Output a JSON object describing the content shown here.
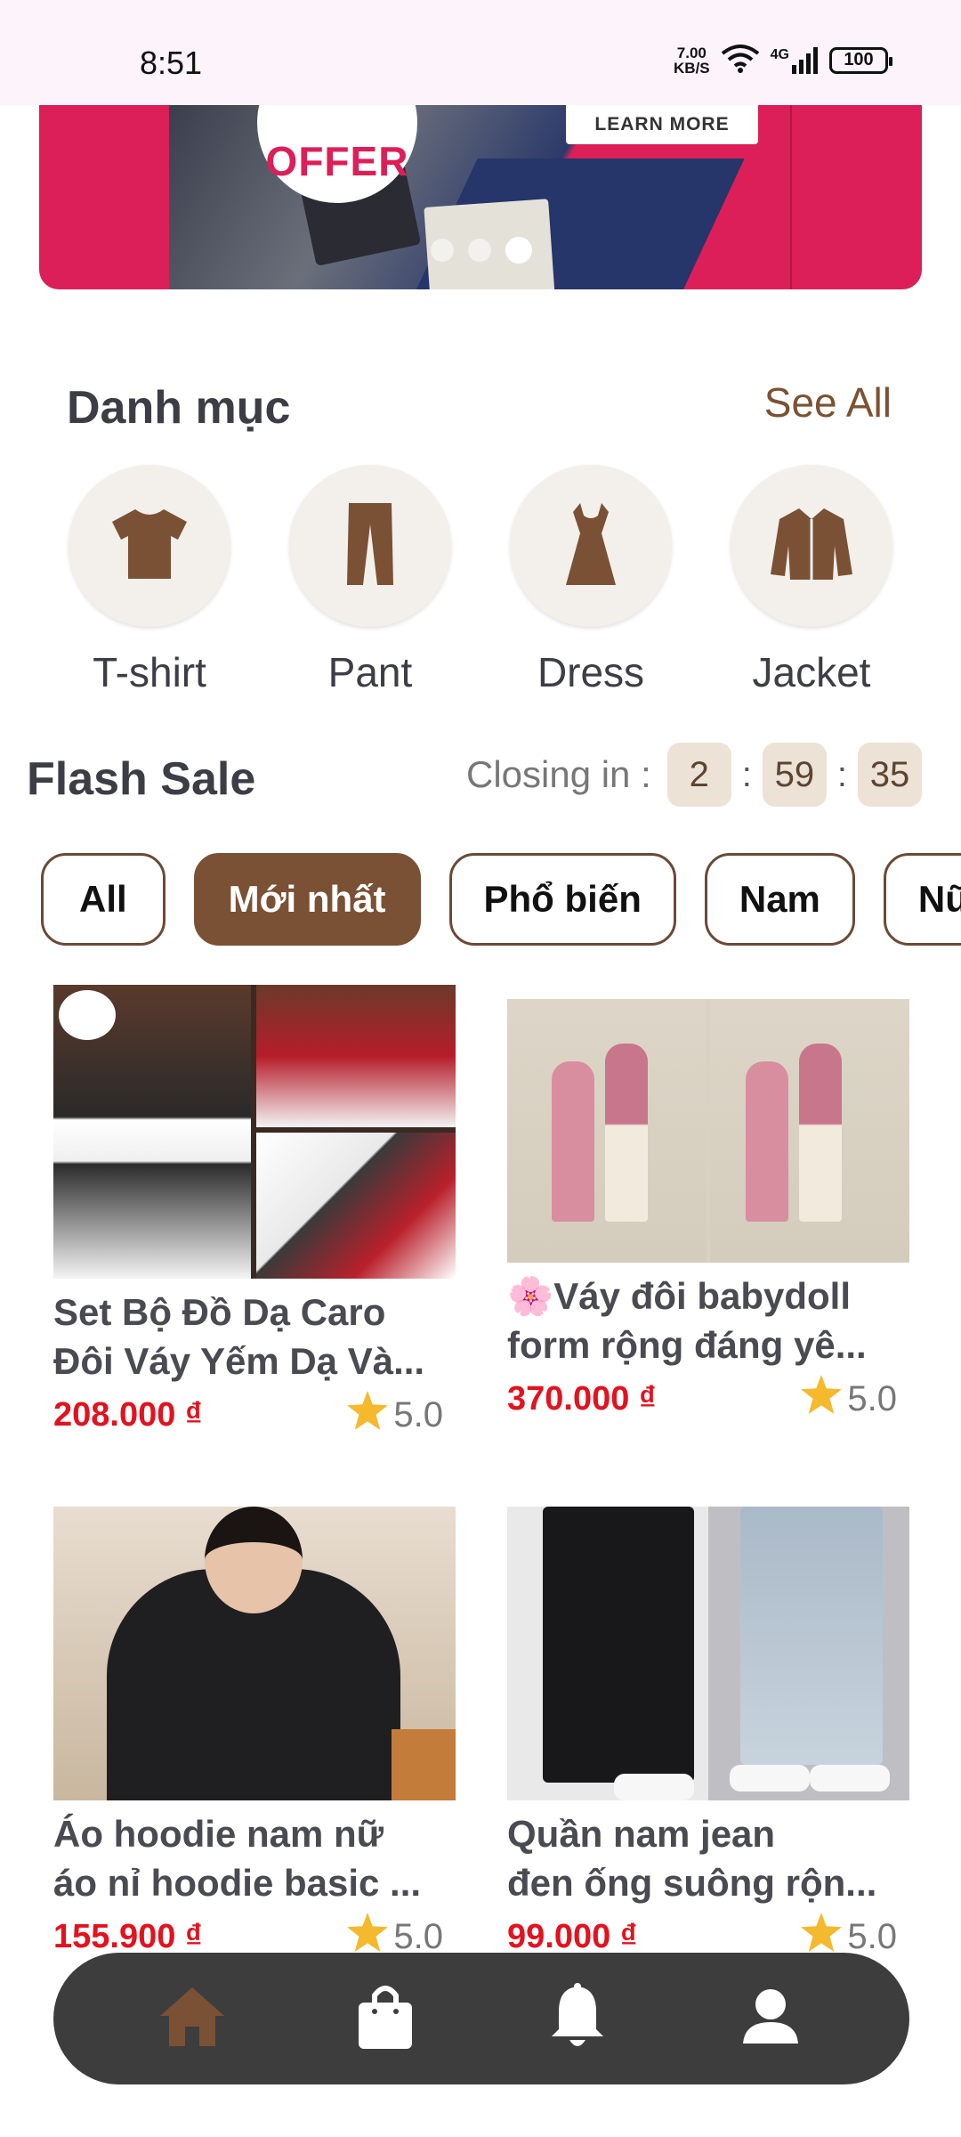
{
  "status_bar": {
    "time": "8:51",
    "net_speed_value": "7.00",
    "net_speed_unit": "KB/S",
    "network": "4G",
    "battery": "100"
  },
  "banner": {
    "offer_text": "OFFER",
    "learn_more": "LEARN MORE",
    "dots_count": 3,
    "active_dot": 2
  },
  "categories": {
    "title": "Danh mục",
    "see_all": "See All",
    "items": [
      {
        "label": "T-shirt",
        "icon": "tshirt-icon"
      },
      {
        "label": "Pant",
        "icon": "pants-icon"
      },
      {
        "label": "Dress",
        "icon": "dress-icon"
      },
      {
        "label": "Jacket",
        "icon": "jacket-icon"
      }
    ]
  },
  "flash_sale": {
    "title": "Flash Sale",
    "closing_label": "Closing in :",
    "hours": "2",
    "minutes": "59",
    "seconds": "35"
  },
  "filters": [
    {
      "label": "All",
      "active": false
    },
    {
      "label": "Mới nhất",
      "active": true
    },
    {
      "label": "Phổ biến",
      "active": false
    },
    {
      "label": "Nam",
      "active": false
    },
    {
      "label": "Nữ",
      "active": false
    }
  ],
  "products": [
    {
      "name_line1": "Set Bộ Đồ Dạ Caro",
      "name_line2": "Đôi Váy Yếm Dạ Và...",
      "price": "208.000 ₫",
      "rating": "5.0"
    },
    {
      "name_line1": "🌸Váy đôi babydoll",
      "name_line2": "form rộng đáng yê...",
      "price": "370.000 ₫",
      "rating": "5.0"
    },
    {
      "name_line1": "Áo hoodie nam nữ",
      "name_line2": "áo nỉ hoodie basic ...",
      "price": "155.900 ₫",
      "rating": "5.0"
    },
    {
      "name_line1": "Quần nam jean",
      "name_line2": "đen ống suông rộn...",
      "price": "99.000 ₫",
      "rating": "5.0"
    }
  ],
  "bottom_nav": [
    {
      "icon": "home-icon",
      "active": true
    },
    {
      "icon": "shopping-bag-icon",
      "active": false
    },
    {
      "icon": "bell-icon",
      "active": false
    },
    {
      "icon": "profile-icon",
      "active": false
    }
  ],
  "colors": {
    "accent_brown": "#7a5135",
    "price_red": "#e3121e",
    "banner_pink": "#dc1f58",
    "nav_bg": "#3d3d3d",
    "star": "#f5b92e"
  }
}
